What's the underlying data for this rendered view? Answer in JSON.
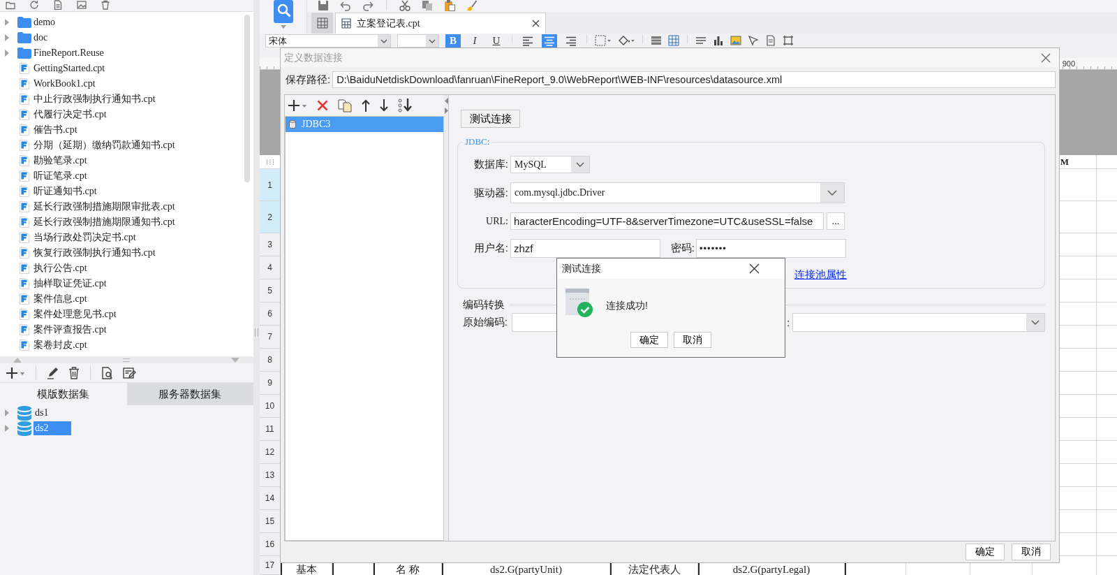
{
  "left_panel": {
    "file_tree": [
      {
        "kind": "folder",
        "label": "demo",
        "expanded": false
      },
      {
        "kind": "folder",
        "label": "doc",
        "expanded": false
      },
      {
        "kind": "folder",
        "label": "FineReport.Reuse",
        "expanded": false
      },
      {
        "kind": "file",
        "label": "GettingStarted.cpt"
      },
      {
        "kind": "file",
        "label": "WorkBook1.cpt"
      },
      {
        "kind": "file",
        "label": "中止行政强制执行通知书.cpt"
      },
      {
        "kind": "file",
        "label": "代履行决定书.cpt"
      },
      {
        "kind": "file",
        "label": "催告书.cpt"
      },
      {
        "kind": "file",
        "label": "分期（延期）缴纳罚款通知书.cpt"
      },
      {
        "kind": "file",
        "label": "勘验笔录.cpt"
      },
      {
        "kind": "file",
        "label": "听证笔录.cpt"
      },
      {
        "kind": "file",
        "label": "听证通知书.cpt"
      },
      {
        "kind": "file",
        "label": "延长行政强制措施期限审批表.cpt"
      },
      {
        "kind": "file",
        "label": "延长行政强制措施期限通知书.cpt"
      },
      {
        "kind": "file",
        "label": "当场行政处罚决定书.cpt"
      },
      {
        "kind": "file",
        "label": "恢复行政强制执行通知书.cpt"
      },
      {
        "kind": "file",
        "label": "执行公告.cpt"
      },
      {
        "kind": "file",
        "label": "抽样取证凭证.cpt"
      },
      {
        "kind": "file",
        "label": "案件信息.cpt"
      },
      {
        "kind": "file",
        "label": "案件处理意见书.cpt"
      },
      {
        "kind": "file",
        "label": "案件评查报告.cpt"
      },
      {
        "kind": "file",
        "label": "案卷封皮.cpt"
      }
    ],
    "dataset_tabs": [
      {
        "label": "模版数据集",
        "selected": true
      },
      {
        "label": "服务器数据集",
        "selected": false
      }
    ],
    "datasets": [
      {
        "label": "ds1",
        "expanded": false,
        "selected": false
      },
      {
        "label": "ds2",
        "expanded": false,
        "selected": true
      }
    ]
  },
  "editor": {
    "document_tabs": [
      {
        "label": "立案登记表.cpt",
        "selected": true
      }
    ],
    "format_toolbar": {
      "font": "宋体",
      "toggles": [
        {
          "kind": "bold",
          "label": "B",
          "on": true
        },
        {
          "kind": "italic",
          "label": "I",
          "on": false
        },
        {
          "kind": "underline",
          "label": "U",
          "on": false
        }
      ],
      "alignment": [
        {
          "kind": "left",
          "selected": false
        },
        {
          "kind": "center",
          "selected": true
        },
        {
          "kind": "right",
          "selected": false
        }
      ]
    },
    "ruler_label": "900",
    "grid": {
      "column_headers": [
        "M"
      ],
      "rows": [
        {
          "label": "1",
          "selected": true
        },
        {
          "label": "2",
          "selected": true
        },
        {
          "label": "3",
          "selected": false
        },
        {
          "label": "4",
          "selected": false
        },
        {
          "label": "5",
          "selected": false
        },
        {
          "label": "6",
          "selected": false
        },
        {
          "label": "7",
          "selected": false
        },
        {
          "label": "8",
          "selected": false
        },
        {
          "label": "9",
          "selected": false
        },
        {
          "label": "10",
          "selected": false
        },
        {
          "label": "11",
          "selected": false
        },
        {
          "label": "12",
          "selected": false
        },
        {
          "label": "13",
          "selected": false
        },
        {
          "label": "14",
          "selected": false
        },
        {
          "label": "15",
          "selected": false
        },
        {
          "label": "16",
          "selected": false
        },
        {
          "label": "17",
          "selected": false
        }
      ],
      "last_row_cells": [
        "基本",
        "名 称",
        "ds2.G(partyUnit)",
        "法定代表人",
        "ds2.G(partyLegal)"
      ]
    }
  },
  "dialog": {
    "title": "定义数据连接",
    "active": false,
    "save_path": {
      "label": "保存路径:",
      "value": "D:\\BaiduNetdiskDownload\\fanruan\\FineReport_9.0\\WebReport\\WEB-INF\\resources\\datasource.xml"
    },
    "connections": [
      {
        "label": "JDBC3",
        "selected": true
      }
    ],
    "test_button": "测试连接",
    "jdbc": {
      "title": "JDBC:",
      "database": {
        "label": "数据库:",
        "value": "MySQL"
      },
      "driver": {
        "label": "驱动器:",
        "value": "com.mysql.jdbc.Driver"
      },
      "url": {
        "label": "URL:",
        "value": "haracterEncoding=UTF-8&serverTimezone=UTC&useSSL=false",
        "button": "..."
      },
      "username": {
        "label": "用户名:",
        "value": "zhzf"
      },
      "password": {
        "label": "密码:",
        "value": "•••••••"
      },
      "pool_link": "连接池属性"
    },
    "encoding": {
      "title": "编码转换",
      "source": {
        "label": "原始编码:"
      },
      "target": {
        "label": ":"
      }
    },
    "buttons": [
      "确定",
      "取消"
    ]
  },
  "popup": {
    "title": "测试连接",
    "message": "连接成功!",
    "buttons": [
      "确定",
      "取消"
    ]
  }
}
